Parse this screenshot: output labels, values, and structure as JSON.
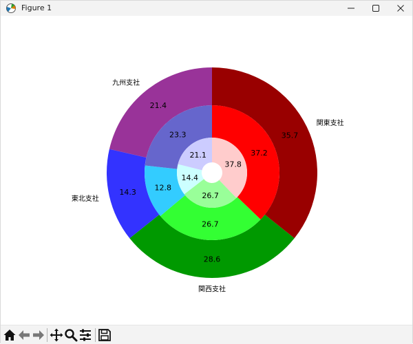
{
  "window": {
    "title": "Figure 1"
  },
  "toolbar": {
    "buttons": [
      {
        "name": "home-icon"
      },
      {
        "name": "back-arrow-icon"
      },
      {
        "name": "forward-arrow-icon"
      },
      {
        "name": "pan-move-icon"
      },
      {
        "name": "zoom-magnifier-icon"
      },
      {
        "name": "configure-subplots-icon"
      },
      {
        "name": "save-floppy-icon"
      }
    ]
  },
  "chart_data": {
    "type": "pie",
    "style": "nested-donut",
    "start_angle_deg": 90,
    "direction": "clockwise",
    "rings": [
      {
        "level": "outer",
        "labels": [
          "関東支社",
          "関西支社",
          "東北支社",
          "九州支社"
        ],
        "values": [
          35.7,
          28.6,
          14.3,
          21.4
        ],
        "colors": [
          "#990000",
          "#009900",
          "#3333ff",
          "#993399"
        ]
      },
      {
        "level": "middle",
        "values": [
          37.2,
          26.7,
          12.8,
          23.3
        ],
        "colors": [
          "#ff0000",
          "#33ff33",
          "#33ccff",
          "#6666cc"
        ]
      },
      {
        "level": "inner",
        "values": [
          37.8,
          26.7,
          14.4,
          21.1
        ],
        "colors": [
          "#ffcccc",
          "#99ff99",
          "#ccffff",
          "#ccccff"
        ]
      }
    ]
  }
}
